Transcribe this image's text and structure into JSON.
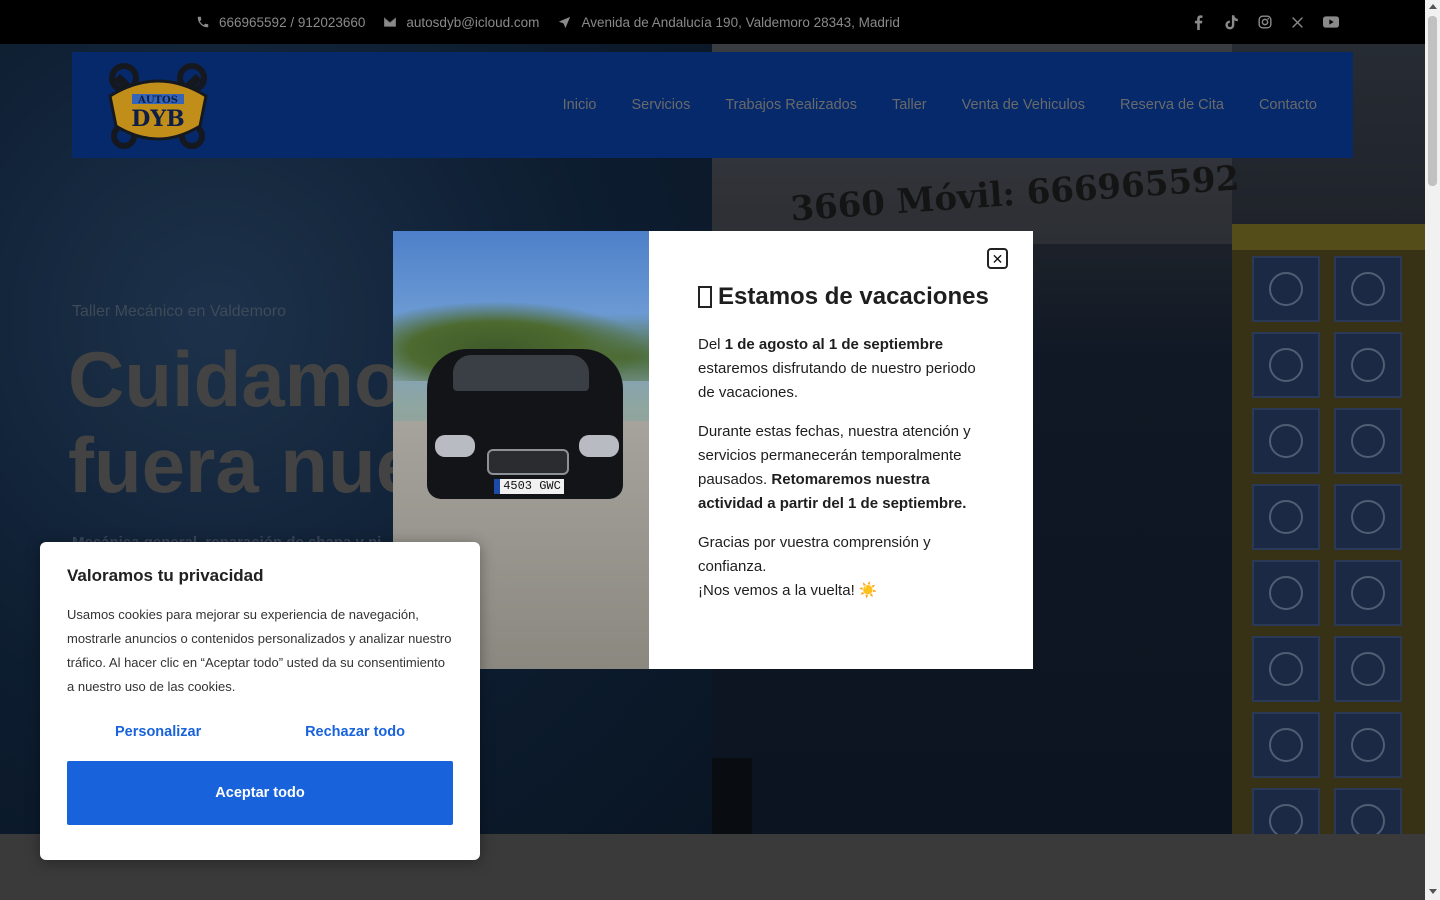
{
  "topbar": {
    "phone": "666965592 / 912023660",
    "email": "autosdyb@icloud.com",
    "address": "Avenida de Andalucía 190, Valdemoro 28343, Madrid",
    "social_icons": [
      "facebook-icon",
      "tiktok-icon",
      "instagram-icon",
      "x-icon",
      "youtube-icon"
    ]
  },
  "header": {
    "logo_top": "AUTOS",
    "logo_main": "DYB",
    "nav": [
      "Inicio",
      "Servicios",
      "Trabajos Realizados",
      "Taller",
      "Venta de Vehiculos",
      "Reserva de Cita",
      "Contacto"
    ]
  },
  "hero": {
    "subtitle": "Taller Mecánico en Valdemoro",
    "title_line1": "Cuidamos",
    "title_line2": "fuera nue",
    "description": "Mecánica general, reparación de chapa y pi",
    "banner_text": "3660 Móvil: 666965592"
  },
  "popup": {
    "title": "Estamos de vacaciones",
    "p1_pre": "Del ",
    "p1_bold": "1 de agosto al 1 de septiembre",
    "p1_post": " estaremos disfrutando de nuestro periodo de vacaciones.",
    "p2_pre": "Durante estas fechas, nuestra atención y servicios permanecerán temporalmente pausados. ",
    "p2_bold": "Retomaremos nuestra actividad a partir del 1 de septiembre.",
    "p3_line1": "Gracias por vuestra comprensión y confianza.",
    "p3_line2": "¡Nos vemos a la vuelta! ☀️",
    "plate": "4503 GWC",
    "close_icon": "close-icon"
  },
  "cookie": {
    "title": "Valoramos tu privacidad",
    "text": "Usamos cookies para mejorar su experiencia de navegación, mostrarle anuncios o contenidos personalizados y analizar nuestro tráfico. Al hacer clic en “Aceptar todo” usted da su consentimiento a nuestro uso de las cookies.",
    "customize": "Personalizar",
    "reject": "Rechazar todo",
    "accept": "Aceptar todo"
  },
  "colors": {
    "nav_bg": "#05296b",
    "accept_bg": "#1863dc",
    "link": "#1863dc"
  }
}
